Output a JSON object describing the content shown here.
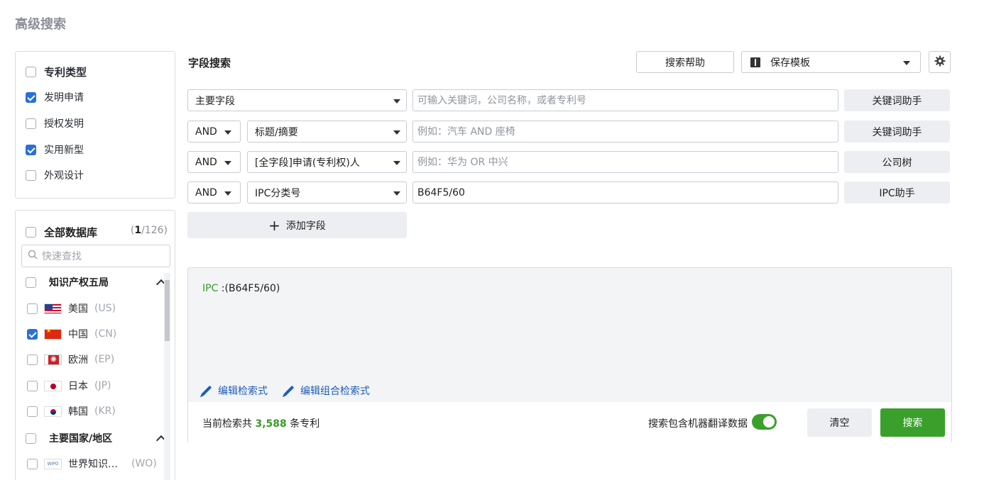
{
  "page": {
    "title": "高级搜索"
  },
  "patent_types": {
    "header": "专利类型",
    "items": [
      {
        "label": "发明申请",
        "checked": true
      },
      {
        "label": "授权发明",
        "checked": false
      },
      {
        "label": "实用新型",
        "checked": true
      },
      {
        "label": "外观设计",
        "checked": false
      }
    ]
  },
  "databases": {
    "header": "全部数据库",
    "count_selected": "1",
    "count_total": "/126)",
    "count_open": "(",
    "search_placeholder": "快速查找",
    "groups": [
      {
        "label": "知识产权五局"
      },
      {
        "label": "主要国家/地区"
      }
    ],
    "items": [
      {
        "flag": "us",
        "name": "美国",
        "code": "(US)",
        "checked": false
      },
      {
        "flag": "cn",
        "name": "中国",
        "code": "(CN)",
        "checked": true
      },
      {
        "flag": "ep",
        "name": "欧洲",
        "code": "(EP)",
        "checked": false
      },
      {
        "flag": "jp",
        "name": "日本",
        "code": "(JP)",
        "checked": false
      },
      {
        "flag": "kr",
        "name": "韩国",
        "code": "(KR)",
        "checked": false
      },
      {
        "flag": "wipo",
        "name": "世界知识…",
        "code": "(WO)",
        "checked": false,
        "flag_text": "WIPO"
      }
    ]
  },
  "field_search": {
    "title": "字段搜索",
    "help_label": "搜索帮助",
    "template_label": "保存模板",
    "add_field_label": "添加字段",
    "rows": [
      {
        "op": "",
        "field": "主要字段",
        "value": "",
        "placeholder": "可输入关键词，公司名称，或者专利号",
        "helper": "关键词助手"
      },
      {
        "op": "AND",
        "field": "标题/摘要",
        "value": "",
        "placeholder": "例如：汽车 AND 座椅",
        "helper": "关键词助手"
      },
      {
        "op": "AND",
        "field": "[全字段]申请(专利权)人",
        "value": "",
        "placeholder": "例如：华为 OR 中兴",
        "helper": "公司树"
      },
      {
        "op": "AND",
        "field": "IPC分类号",
        "value": "B64F5/60",
        "placeholder": "",
        "helper": "IPC助手"
      }
    ]
  },
  "query": {
    "field": "IPC",
    "expr": " :(B64F5/60)",
    "edit_label": "编辑检索式",
    "edit_combo_label": "编辑组合检索式",
    "result_prefix": "当前检索共 ",
    "result_count": "3,588",
    "result_suffix": " 条专利",
    "machine_translation_label": "搜索包含机器翻译数据",
    "machine_translation_on": true,
    "clear_label": "清空",
    "search_label": "搜索"
  },
  "colors": {
    "accent_green": "#3aa02b",
    "link_blue": "#1f5db8",
    "checkbox_blue": "#2b6fd6"
  }
}
